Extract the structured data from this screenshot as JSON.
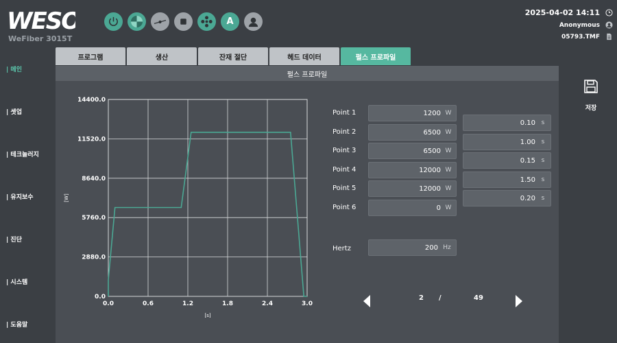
{
  "app": {
    "logo_text": "WESO",
    "model": "WeFiber 3015T"
  },
  "toolbar": {
    "buttons": [
      {
        "icon": "power-icon",
        "color": "teal"
      },
      {
        "icon": "quarter-pie-icon",
        "color": "teal"
      },
      {
        "icon": "cutter-line-icon",
        "color": "grey"
      },
      {
        "icon": "stop-icon",
        "color": "grey"
      },
      {
        "icon": "fan-icon",
        "color": "teal"
      },
      {
        "icon": "auto-icon",
        "color": "teal",
        "letter": "A"
      },
      {
        "icon": "user-icon",
        "color": "grey"
      }
    ]
  },
  "status": {
    "datetime": "2025-04-02 14:11",
    "user": "Anonymous",
    "file": "05793.TMF"
  },
  "sidenav": {
    "items": [
      {
        "label": "| 메인",
        "active": true
      },
      {
        "label": "| 셋업",
        "active": false
      },
      {
        "label": "| 테크놀러지",
        "active": false
      },
      {
        "label": "| 유지보수",
        "active": false
      },
      {
        "label": "| 진단",
        "active": false
      },
      {
        "label": "| 시스템",
        "active": false
      },
      {
        "label": "| 도움말",
        "active": false
      }
    ]
  },
  "tabs": [
    {
      "label": "프로그램",
      "active": false
    },
    {
      "label": "생산",
      "active": false
    },
    {
      "label": "잔재 절단",
      "active": false
    },
    {
      "label": "헤드 데이터",
      "active": false
    },
    {
      "label": "펄스 프로파일",
      "active": true
    }
  ],
  "panel": {
    "title": "펄스 프로파일"
  },
  "chart_data": {
    "type": "line",
    "x_label": "[s]",
    "y_label": "[W]",
    "xlim": [
      0.0,
      3.0
    ],
    "ylim": [
      0.0,
      14400.0
    ],
    "x_ticks": [
      "0.0",
      "0.6",
      "1.2",
      "1.8",
      "2.4",
      "3.0"
    ],
    "y_ticks": [
      "0.0",
      "2880.0",
      "5760.0",
      "8640.0",
      "11520.0",
      "14400.0"
    ],
    "grid": true,
    "line_color": "#4ba894",
    "x": [
      0.0,
      0.1,
      1.1,
      1.25,
      2.75,
      2.95
    ],
    "y": [
      1200,
      6500,
      6500,
      12000,
      12000,
      0
    ]
  },
  "points": [
    {
      "label": "Point 1",
      "power": "1200",
      "power_unit": "W"
    },
    {
      "label": "Point 2",
      "power": "6500",
      "power_unit": "W"
    },
    {
      "label": "Point 3",
      "power": "6500",
      "power_unit": "W"
    },
    {
      "label": "Point 4",
      "power": "12000",
      "power_unit": "W"
    },
    {
      "label": "Point 5",
      "power": "12000",
      "power_unit": "W"
    },
    {
      "label": "Point 6",
      "power": "0",
      "power_unit": "W"
    }
  ],
  "durations": [
    {
      "value": "0.10",
      "unit": "s"
    },
    {
      "value": "1.00",
      "unit": "s"
    },
    {
      "value": "0.15",
      "unit": "s"
    },
    {
      "value": "1.50",
      "unit": "s"
    },
    {
      "value": "0.20",
      "unit": "s"
    }
  ],
  "hertz": {
    "label": "Hertz",
    "value": "200",
    "unit": "Hz"
  },
  "pager": {
    "current": "2",
    "separator": "/",
    "total": "49"
  },
  "save": {
    "label": "저장"
  }
}
